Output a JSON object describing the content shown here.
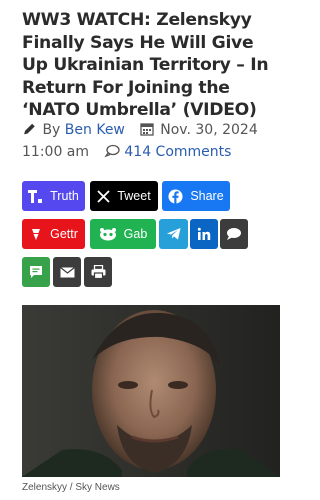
{
  "article": {
    "title": "WW3 WATCH: Zelenskyy Finally Says He Will Give Up Ukrainian Territory – In Return For Joining the ‘NATO Umbrella’ (VIDEO)",
    "by_prefix": "By",
    "author": "Ben Kew",
    "date": "Nov. 30, 2024 11:00 am",
    "comments": "414 Comments"
  },
  "share": {
    "truth": "Truth",
    "tweet": "Tweet",
    "facebook": "Share",
    "gettr": "Gettr",
    "gab": "Gab"
  },
  "image": {
    "caption": "Zelenskyy / Sky News"
  },
  "colors": {
    "truth": "#5448ee",
    "x": "#000000",
    "facebook": "#1877f2",
    "gettr": "#e8141c",
    "gab": "#21b352",
    "telegram": "#279fd9",
    "linkedin": "#0a66c2",
    "comment": "#3c3c3c",
    "sms": "#37a24a",
    "email": "#3c3c3c",
    "print": "#3c3c3c"
  }
}
